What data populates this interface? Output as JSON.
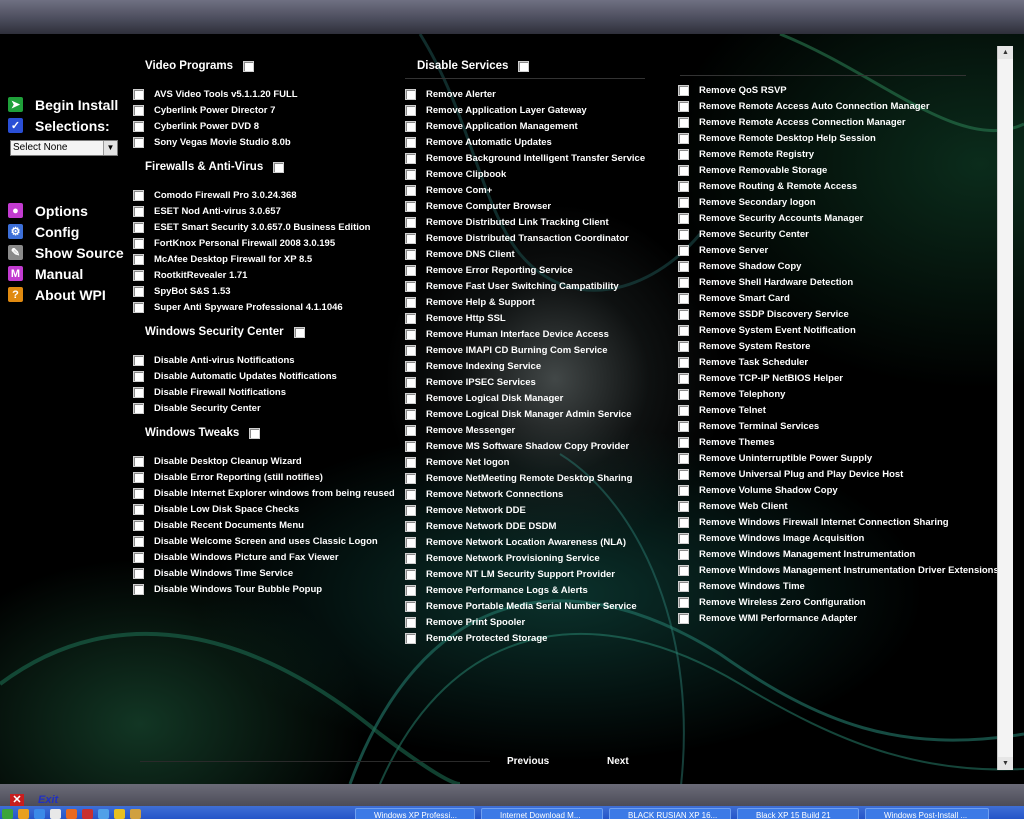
{
  "menu": {
    "begin_install": "Begin Install",
    "selections": "Selections:",
    "select_none": "Select None",
    "options": "Options",
    "config": "Config",
    "show_source": "Show Source",
    "manual": "Manual",
    "about": "About WPI"
  },
  "groups": {
    "video": {
      "title": "Video Programs",
      "items": [
        "AVS Video Tools v5.1.1.20 FULL",
        "Cyberlink Power Director 7",
        "Cyberlink Power DVD 8",
        "Sony Vegas Movie Studio 8.0b"
      ]
    },
    "firewalls": {
      "title": "Firewalls & Anti-Virus",
      "items": [
        "Comodo Firewall Pro 3.0.24.368",
        "ESET Nod Anti-virus 3.0.657",
        "ESET Smart Security 3.0.657.0 Business Edition",
        "FortKnox Personal Firewall 2008 3.0.195",
        "McAfee Desktop Firewall for XP 8.5",
        "RootkitRevealer 1.71",
        "SpyBot S&S 1.53",
        "Super Anti Spyware Professional 4.1.1046"
      ]
    },
    "security_center": {
      "title": "Windows Security Center",
      "items": [
        "Disable Anti-virus Notifications",
        "Disable Automatic Updates Notifications",
        "Disable Firewall Notifications",
        "Disable Security Center"
      ]
    },
    "tweaks": {
      "title": "Windows Tweaks",
      "items": [
        "Disable Desktop Cleanup Wizard",
        "Disable Error Reporting (still notifies)",
        "Disable Internet Explorer windows from being reused",
        "Disable Low Disk Space Checks",
        "Disable Recent Documents Menu",
        "Disable Welcome Screen and uses Classic Logon",
        "Disable Windows Picture and Fax Viewer",
        "Disable Windows Time Service",
        "Disable Windows Tour Bubble Popup"
      ]
    },
    "services": {
      "title": "Disable Services",
      "col1": [
        "Remove Alerter",
        "Remove Application Layer Gateway",
        "Remove Application Management",
        "Remove Automatic Updates",
        "Remove Background Intelligent Transfer Service",
        "Remove Clipbook",
        "Remove Com+",
        "Remove Computer Browser",
        "Remove Distributed Link Tracking Client",
        "Remove Distributed Transaction Coordinator",
        "Remove DNS Client",
        "Remove Error Reporting Service",
        "Remove Fast User Switching Campatibility",
        "Remove Help & Support",
        "Remove Http SSL",
        "Remove Human Interface Device Access",
        "Remove IMAPI CD Burning Com Service",
        "Remove Indexing Service",
        "Remove IPSEC Services",
        "Remove Logical Disk Manager",
        "Remove Logical Disk Manager Admin Service",
        "Remove Messenger",
        "Remove MS Software Shadow Copy Provider",
        "Remove Net logon",
        "Remove NetMeeting Remote Desktop Sharing",
        "Remove Network Connections",
        "Remove Network DDE",
        "Remove Network DDE DSDM",
        "Remove Network Location Awareness (NLA)",
        "Remove Network Provisioning Service",
        "Remove NT LM Security Support Provider",
        "Remove Performance Logs & Alerts",
        "Remove Portable Media Serial Number Service",
        "Remove Print Spooler",
        "Remove Protected Storage"
      ],
      "col2": [
        "Remove QoS RSVP",
        "Remove Remote Access Auto Connection Manager",
        "Remove Remote Access Connection Manager",
        "Remove Remote Desktop Help Session",
        "Remove Remote Registry",
        "Remove Removable Storage",
        "Remove Routing & Remote Access",
        "Remove Secondary logon",
        "Remove Security Accounts Manager",
        "Remove Security Center",
        "Remove Server",
        "Remove Shadow Copy",
        "Remove Shell Hardware Detection",
        "Remove Smart Card",
        "Remove SSDP Discovery Service",
        "Remove System Event Notification",
        "Remove System Restore",
        "Remove Task Scheduler",
        "Remove TCP-IP NetBIOS Helper",
        "Remove Telephony",
        "Remove Telnet",
        "Remove Terminal Services",
        "Remove Themes",
        "Remove Uninterruptible Power Supply",
        "Remove Universal Plug and Play Device Host",
        "Remove Volume Shadow Copy",
        "Remove Web Client",
        "Remove Windows Firewall Internet Connection Sharing",
        "Remove Windows Image Acquisition",
        "Remove Windows Management Instrumentation",
        "Remove Windows Management Instrumentation Driver Extensions",
        "Remove Windows Time",
        "Remove Wireless Zero Configuration",
        "Remove WMI Performance Adapter"
      ]
    }
  },
  "nav": {
    "previous": "Previous",
    "next": "Next"
  },
  "status": {
    "exit": "Exit"
  },
  "taskbar": {
    "buttons": [
      "Windows XP Professi...",
      "Internet Download M...",
      "BLACK RUSIAN XP 16...",
      "Black XP 15 Build 21",
      "Windows Post-Install ..."
    ]
  },
  "colors": {
    "background": "#000000",
    "text": "#ffffff",
    "accent_green": "#1e6e55",
    "taskbar_blue": "#2555c8"
  }
}
